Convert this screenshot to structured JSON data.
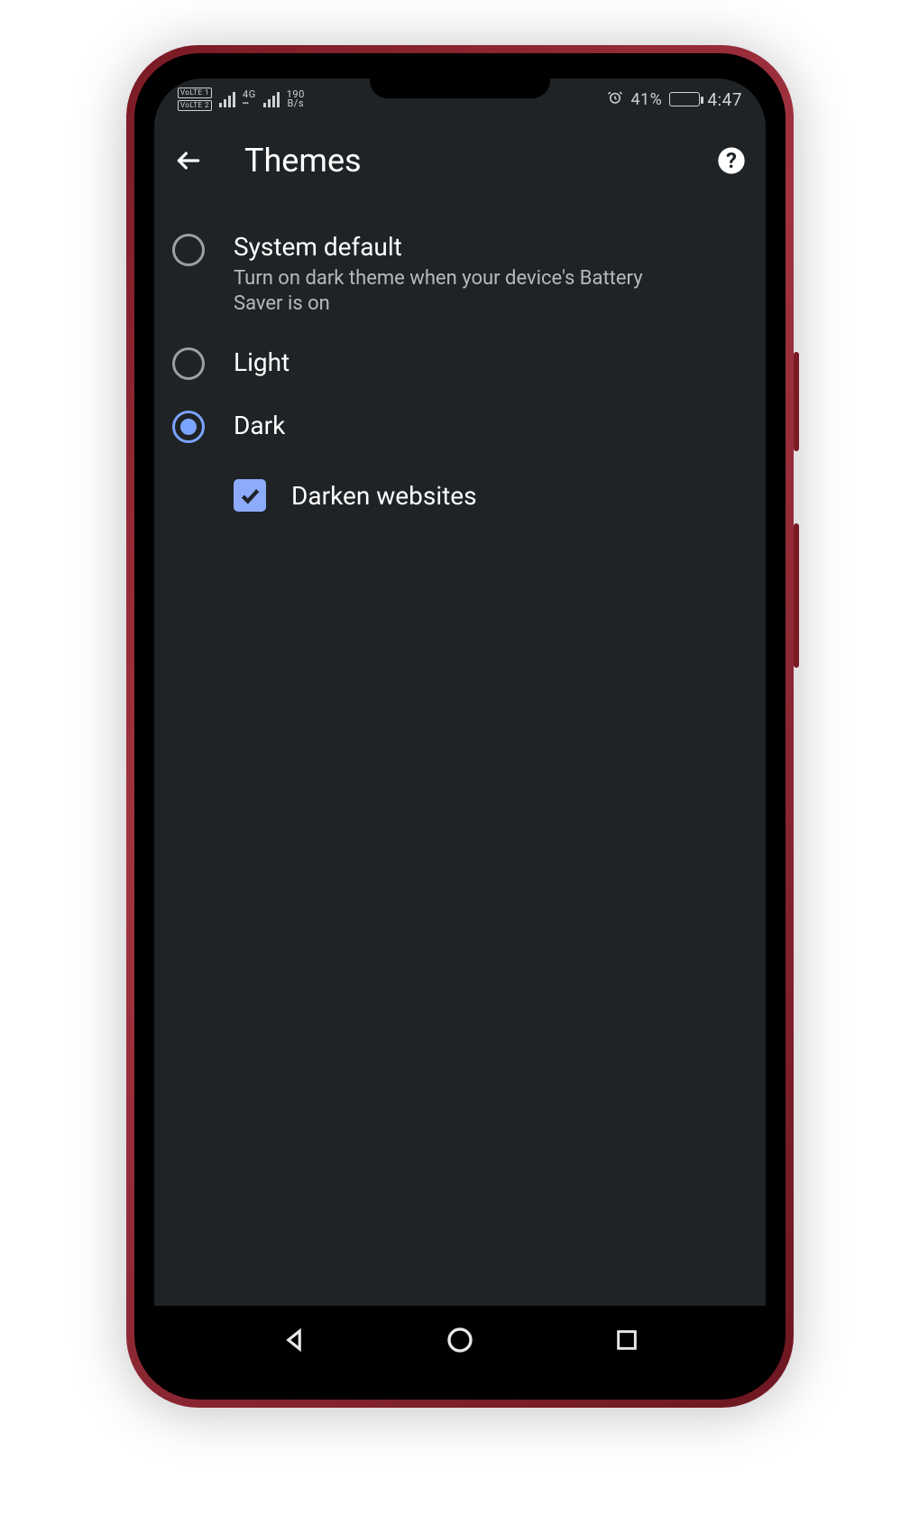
{
  "status": {
    "volte1": "VoLTE 1",
    "volte2": "VoLTE 2",
    "net_top": "4G",
    "net_bot": "┅",
    "rate_top": "190",
    "rate_bot": "B/s",
    "battery_pct": "41%",
    "battery_fill_pct": 41,
    "time": "4:47"
  },
  "appbar": {
    "title": "Themes"
  },
  "options": [
    {
      "id": "system",
      "title": "System default",
      "sub": "Turn on dark theme when your device's Battery Saver is on",
      "selected": false
    },
    {
      "id": "light",
      "title": "Light",
      "sub": "",
      "selected": false
    },
    {
      "id": "dark",
      "title": "Dark",
      "sub": "",
      "selected": true
    }
  ],
  "darken_websites": {
    "label": "Darken websites",
    "checked": true
  }
}
